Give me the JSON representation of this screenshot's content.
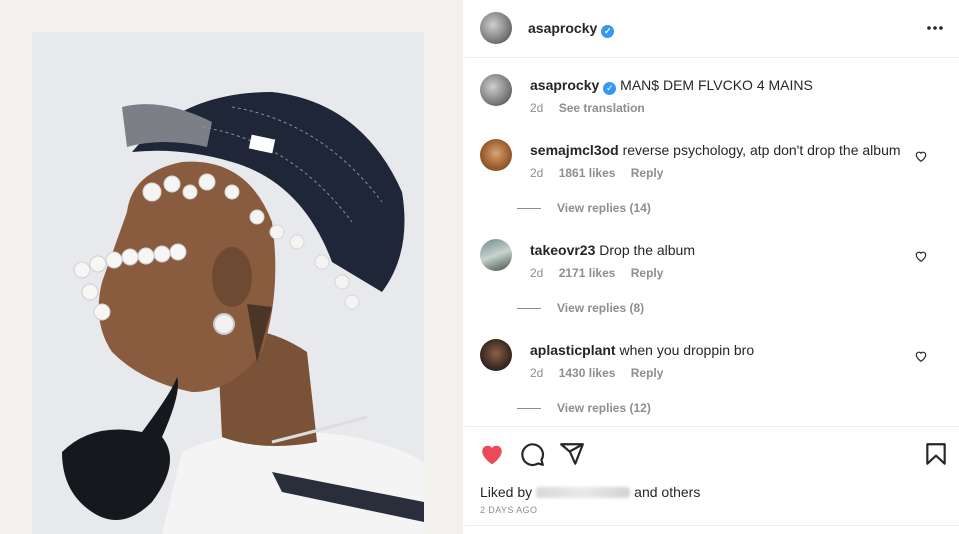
{
  "post": {
    "username": "asaprocky",
    "caption_user": "asaprocky",
    "caption_text": "MAN$ DEM FLVCKO 4 MAINS",
    "caption_age": "2d",
    "see_translation": "See translation"
  },
  "comments": [
    {
      "user": "semajmcl3od",
      "text": "reverse psychology, atp don't drop the album",
      "age": "2d",
      "likes": "1861 likes",
      "reply": "Reply",
      "view_replies": "View replies (14)"
    },
    {
      "user": "takeovr23",
      "text": "Drop the album",
      "age": "2d",
      "likes": "2171 likes",
      "reply": "Reply",
      "view_replies": "View replies (8)"
    },
    {
      "user": "aplasticplant",
      "text": "when you droppin bro",
      "age": "2d",
      "likes": "1430 likes",
      "reply": "Reply",
      "view_replies": "View replies (12)"
    }
  ],
  "footer": {
    "liked_by_prefix": "Liked by",
    "liked_by_suffix": "and others",
    "timestamp": "2 DAYS AGO"
  },
  "icons": {
    "like": "heart-icon",
    "comment": "comment-icon",
    "share": "share-icon",
    "save": "bookmark-icon",
    "more": "more-options-icon",
    "verified": "verified-badge-icon"
  },
  "colors": {
    "liked_heart": "#ed4956",
    "verified": "#3897f0",
    "muted_text": "#8e8e8e"
  }
}
